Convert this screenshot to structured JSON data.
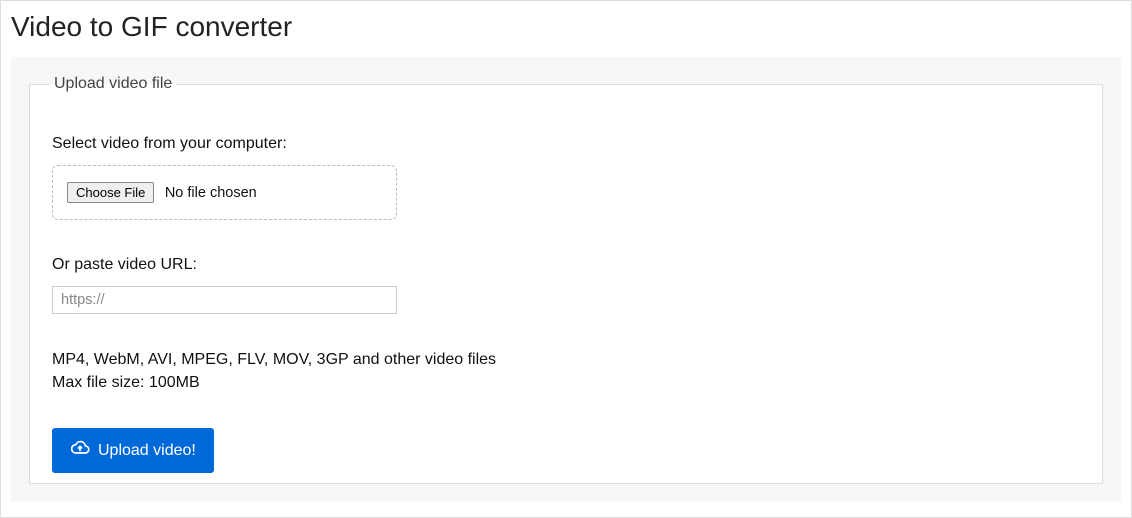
{
  "page": {
    "title": "Video to GIF converter"
  },
  "form": {
    "legend": "Upload video file",
    "select_label": "Select video from your computer:",
    "choose_file_button": "Choose File",
    "file_status": "No file chosen",
    "or_paste_label": "Or paste video URL:",
    "url_placeholder": "https://",
    "url_value": "",
    "info_formats": "MP4, WebM, AVI, MPEG, FLV, MOV, 3GP and other video files",
    "info_maxsize": "Max file size: 100MB",
    "upload_button": "Upload video!"
  }
}
